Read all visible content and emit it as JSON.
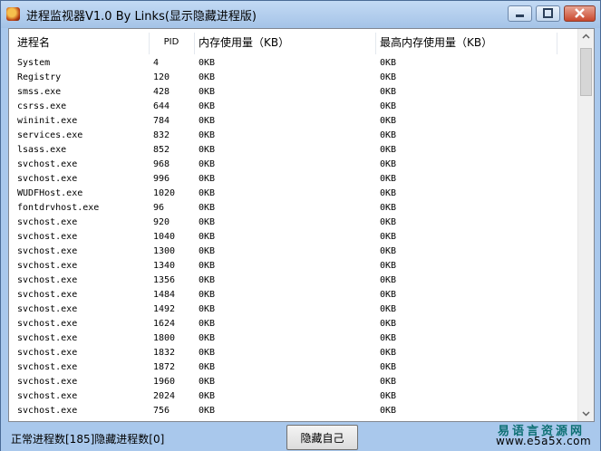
{
  "window": {
    "title": "进程监视器V1.0 By Links(显示隐藏进程版)"
  },
  "table": {
    "columns": [
      "进程名",
      "PID",
      "内存使用量（KB）",
      "最高内存使用量（KB）"
    ],
    "rows": [
      [
        "System",
        "4",
        "0KB",
        "0KB"
      ],
      [
        "Registry",
        "120",
        "0KB",
        "0KB"
      ],
      [
        "smss.exe",
        "428",
        "0KB",
        "0KB"
      ],
      [
        "csrss.exe",
        "644",
        "0KB",
        "0KB"
      ],
      [
        "wininit.exe",
        "784",
        "0KB",
        "0KB"
      ],
      [
        "services.exe",
        "832",
        "0KB",
        "0KB"
      ],
      [
        "lsass.exe",
        "852",
        "0KB",
        "0KB"
      ],
      [
        "svchost.exe",
        "968",
        "0KB",
        "0KB"
      ],
      [
        "svchost.exe",
        "996",
        "0KB",
        "0KB"
      ],
      [
        "WUDFHost.exe",
        "1020",
        "0KB",
        "0KB"
      ],
      [
        "fontdrvhost.exe",
        "96",
        "0KB",
        "0KB"
      ],
      [
        "svchost.exe",
        "920",
        "0KB",
        "0KB"
      ],
      [
        "svchost.exe",
        "1040",
        "0KB",
        "0KB"
      ],
      [
        "svchost.exe",
        "1300",
        "0KB",
        "0KB"
      ],
      [
        "svchost.exe",
        "1340",
        "0KB",
        "0KB"
      ],
      [
        "svchost.exe",
        "1356",
        "0KB",
        "0KB"
      ],
      [
        "svchost.exe",
        "1484",
        "0KB",
        "0KB"
      ],
      [
        "svchost.exe",
        "1492",
        "0KB",
        "0KB"
      ],
      [
        "svchost.exe",
        "1624",
        "0KB",
        "0KB"
      ],
      [
        "svchost.exe",
        "1800",
        "0KB",
        "0KB"
      ],
      [
        "svchost.exe",
        "1832",
        "0KB",
        "0KB"
      ],
      [
        "svchost.exe",
        "1872",
        "0KB",
        "0KB"
      ],
      [
        "svchost.exe",
        "1960",
        "0KB",
        "0KB"
      ],
      [
        "svchost.exe",
        "2024",
        "0KB",
        "0KB"
      ],
      [
        "svchost.exe",
        "756",
        "0KB",
        "0KB"
      ]
    ]
  },
  "status": {
    "text": "正常进程数[185]隐藏进程数[0]",
    "hide_button_label": "隐藏自己"
  },
  "watermark": {
    "brand": "易语言资源网",
    "url": "www.e5a5x.com"
  }
}
